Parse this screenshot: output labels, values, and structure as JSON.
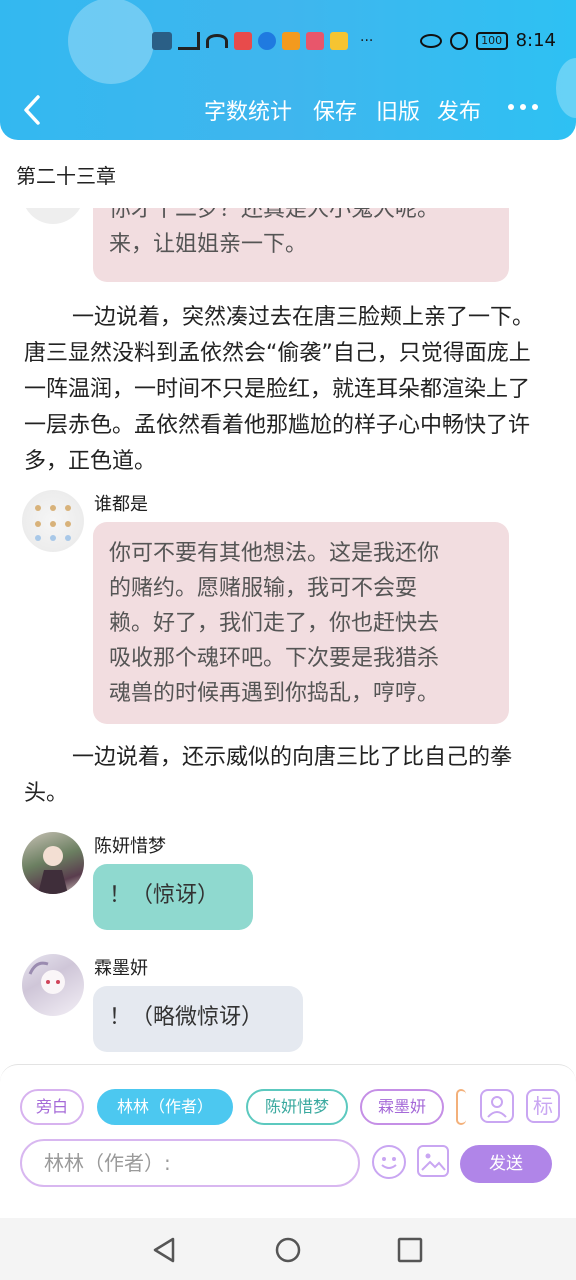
{
  "status_bar": {
    "time": "8:14",
    "battery": "100",
    "overflow": "···"
  },
  "toolbar": {
    "word_count": "字数统计",
    "save": "保存",
    "old_version": "旧版",
    "publish": "发布"
  },
  "chapter": {
    "title": "第二十三章"
  },
  "messages": [
    {
      "type": "bubble",
      "text_lines": [
        "你才十二岁？还真是人小鬼大呢。",
        "来，让姐姐亲一下。"
      ]
    },
    {
      "type": "narration",
      "text": "一边说着，突然凑过去在唐三脸颊上亲了一下。唐三显然没料到孟依然会“偷袭”自己，只觉得面庞上一阵温润，一时间不只是脸红，就连耳朵都渲染上了一层赤色。孟依然看着他那尴尬的样子心中畅快了许多，正色道。"
    },
    {
      "type": "bubble",
      "speaker": "谁都是",
      "text_lines": [
        "你可不要有其他想法。这是我还你",
        "的赌约。愿赌服输，我可不会耍",
        "赖。好了，我们走了，你也赶快去",
        "吸收那个魂环吧。下次要是我猎杀",
        "魂兽的时候再遇到你捣乱，哼哼。"
      ]
    },
    {
      "type": "narration",
      "text": "一边说着，还示威似的向唐三比了比自己的拳头。"
    },
    {
      "type": "bubble",
      "speaker": "陈妍惜梦",
      "text_lines": [
        "！（惊讶）"
      ]
    },
    {
      "type": "bubble",
      "speaker": "霖墨妍",
      "text_lines": [
        "！（略微惊讶）"
      ]
    }
  ],
  "roles": [
    "旁白",
    "林林（作者）",
    "陈妍惜梦",
    "霖墨妍"
  ],
  "role_icons": {
    "add_role": "person-icon",
    "mark": "标"
  },
  "composer": {
    "placeholder": "林林（作者）:",
    "send": "发送"
  },
  "colors": {
    "header": "#3fb6ee",
    "pink_bubble": "#f2dde0",
    "teal_bubble": "#8fd9cf",
    "gray_bubble": "#e5e9f0",
    "accent": "#b085e8",
    "active_chip": "#4cc8f0"
  }
}
